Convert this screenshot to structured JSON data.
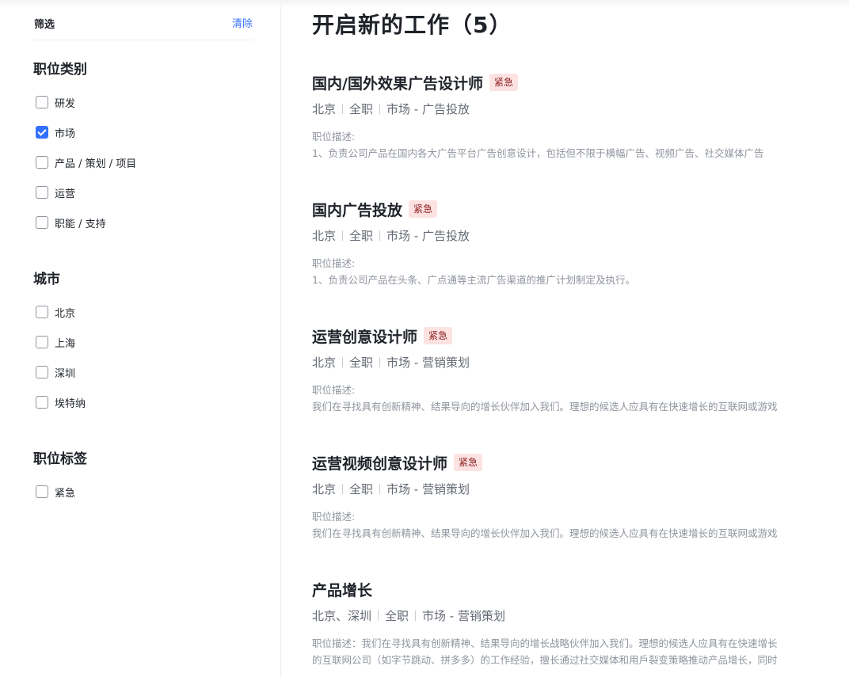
{
  "sidebar": {
    "filter_title": "筛选",
    "clear_label": "清除",
    "groups": [
      {
        "title": "职位类别",
        "options": [
          {
            "label": "研发",
            "checked": false
          },
          {
            "label": "市场",
            "checked": true
          },
          {
            "label": "产品 / 策划 / 项目",
            "checked": false
          },
          {
            "label": "运营",
            "checked": false
          },
          {
            "label": "职能 / 支持",
            "checked": false
          }
        ]
      },
      {
        "title": "城市",
        "options": [
          {
            "label": "北京",
            "checked": false
          },
          {
            "label": "上海",
            "checked": false
          },
          {
            "label": "深圳",
            "checked": false
          },
          {
            "label": "埃特纳",
            "checked": false
          }
        ]
      },
      {
        "title": "职位标签",
        "options": [
          {
            "label": "紧急",
            "checked": false
          }
        ]
      }
    ]
  },
  "main": {
    "title": "开启新的工作（5）",
    "jobs": [
      {
        "title": "国内/国外效果广告设计师",
        "badge": "紧急",
        "city": "北京",
        "type": "全职",
        "category": "市场 - 广告投放",
        "desc_label": "职位描述:",
        "desc_line1": "1、负责公司产品在国内各大广告平台广告创意设计，包括但不限于横幅广告、视频广告、社交媒体广告",
        "desc_line2": ""
      },
      {
        "title": "国内广告投放",
        "badge": "紧急",
        "city": "北京",
        "type": "全职",
        "category": "市场 - 广告投放",
        "desc_label": "职位描述:",
        "desc_line1": "1、负责公司产品在头条、广点通等主流广告渠道的推广计划制定及执行。",
        "desc_line2": ""
      },
      {
        "title": "运营创意设计师",
        "badge": "紧急",
        "city": "北京",
        "type": "全职",
        "category": "市场 - 营销策划",
        "desc_label": "职位描述:",
        "desc_line1": "我们在寻找具有创新精神、结果导向的增长伙伴加入我们。理想的候选人应具有在快速增长的互联网或游戏",
        "desc_line2": ""
      },
      {
        "title": "运营视频创意设计师",
        "badge": "紧急",
        "city": "北京",
        "type": "全职",
        "category": "市场 - 营销策划",
        "desc_label": "职位描述:",
        "desc_line1": "我们在寻找具有创新精神、结果导向的增长伙伴加入我们。理想的候选人应具有在快速增长的互联网或游戏",
        "desc_line2": ""
      },
      {
        "title": "产品增长",
        "badge": "",
        "city": "北京、深圳",
        "type": "全职",
        "category": "市场 - 营销策划",
        "desc_label": "职位描述：我们在寻找具有创新精神、结果导向的增长战略伙伴加入我们。理想的候选人应具有在快速增长",
        "desc_line1": "的互联网公司（如字节跳动、拼多多）的工作经验，擅长通过社交媒体和用戶裂变策略推动产品增长，同时",
        "desc_line2": ""
      }
    ]
  }
}
